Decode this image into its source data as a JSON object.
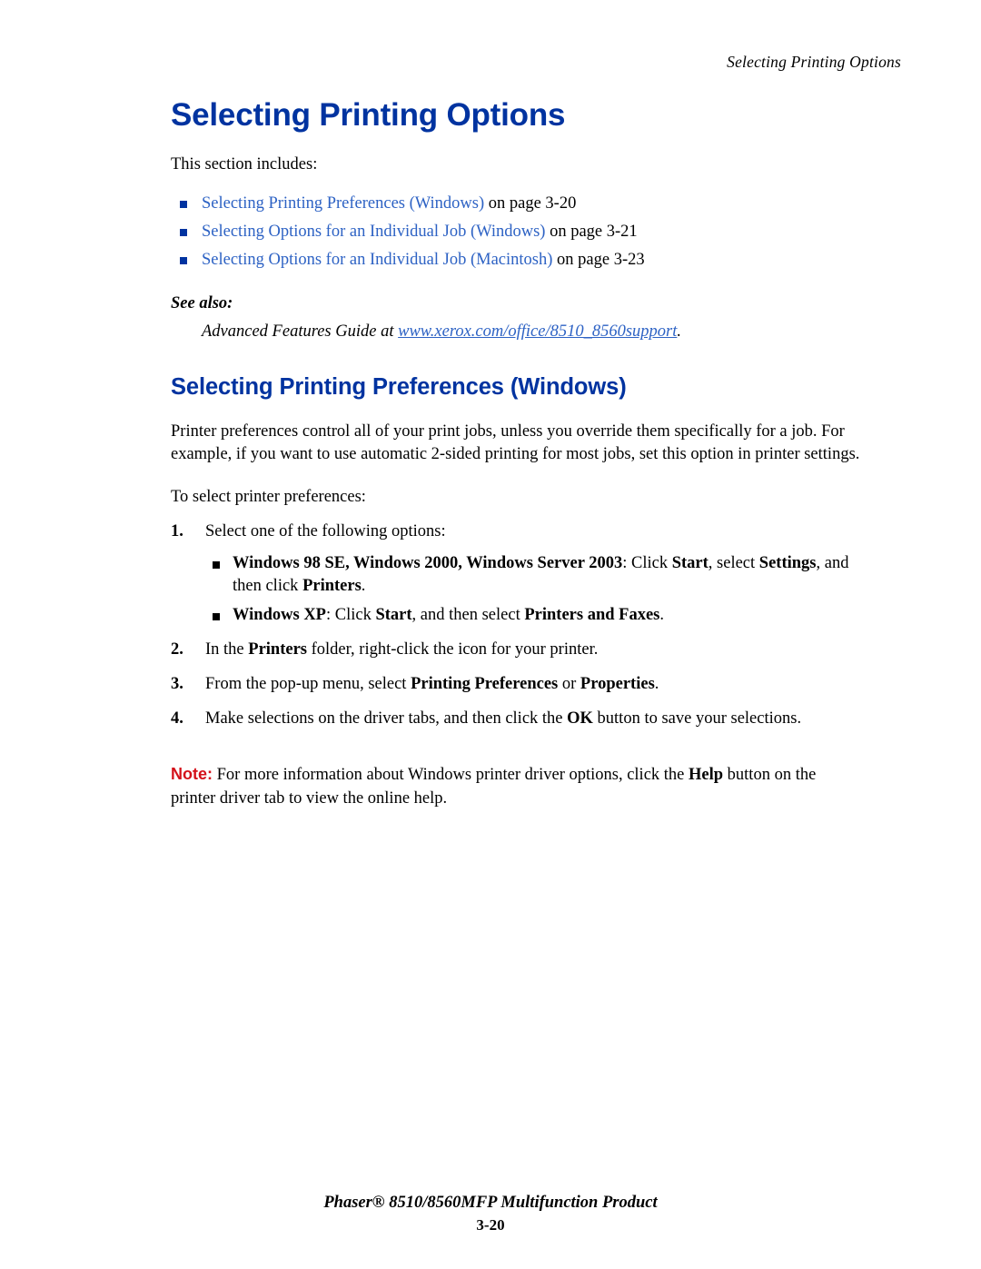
{
  "header": {
    "running_title": "Selecting Printing Options"
  },
  "main": {
    "title": "Selecting Printing Options",
    "intro": "This section includes:",
    "links": [
      {
        "text": "Selecting Printing Preferences (Windows)",
        "suffix": " on page 3-20"
      },
      {
        "text": "Selecting Options for an Individual Job (Windows)",
        "suffix": " on page 3-21"
      },
      {
        "text": "Selecting Options for an Individual Job (Macintosh)",
        "suffix": " on page 3-23"
      }
    ],
    "see_also_label": "See also:",
    "see_also_prefix": "Advanced Features Guide at ",
    "see_also_url": "www.xerox.com/office/8510_8560support",
    "see_also_suffix": ".",
    "section_heading": "Selecting Printing Preferences (Windows)",
    "paragraph_1": "Printer preferences control all of your print jobs, unless you override them specifically for a job. For example, if you want to use automatic 2-sided printing for most jobs, set this option in printer settings.",
    "paragraph_2": "To select printer preferences:",
    "steps": [
      {
        "num": "1.",
        "text": "Select one of the following options:",
        "sub": [
          {
            "b1": "Windows 98 SE, Windows  2000, Windows Server 2003",
            "t1": ": Click ",
            "b2": "Start",
            "t2": ", select ",
            "b3": "Settings",
            "t3": ", and then click ",
            "b4": "Printers",
            "t4": "."
          },
          {
            "b1": "Windows XP",
            "t1": ": Click ",
            "b2": "Start",
            "t2": ", and then select ",
            "b3": "Printers and Faxes",
            "t3": ".",
            "b4": "",
            "t4": ""
          }
        ]
      },
      {
        "num": "2.",
        "parts": [
          {
            "text": "In the ",
            "bold": false
          },
          {
            "text": "Printers",
            "bold": true
          },
          {
            "text": " folder, right-click the icon for your printer.",
            "bold": false
          }
        ]
      },
      {
        "num": "3.",
        "parts": [
          {
            "text": "From the pop-up menu, select ",
            "bold": false
          },
          {
            "text": "Printing Preferences",
            "bold": true
          },
          {
            "text": " or ",
            "bold": false
          },
          {
            "text": "Properties",
            "bold": true
          },
          {
            "text": ".",
            "bold": false
          }
        ]
      },
      {
        "num": "4.",
        "parts": [
          {
            "text": "Make selections on the driver tabs, and then click the ",
            "bold": false
          },
          {
            "text": "OK",
            "bold": true
          },
          {
            "text": " button to save your selections.",
            "bold": false
          }
        ]
      }
    ],
    "note": {
      "label": "Note:",
      "prefix": " For more information about Windows printer driver options, click the ",
      "bold": "Help",
      "suffix": " button on the printer driver tab to view the online help."
    }
  },
  "footer": {
    "product": "Phaser® 8510/8560MFP Multifunction Product",
    "page": "3-20"
  },
  "colors": {
    "heading_blue": "#0033A0",
    "link_blue": "#2D62C4",
    "note_red": "#D4111A"
  }
}
